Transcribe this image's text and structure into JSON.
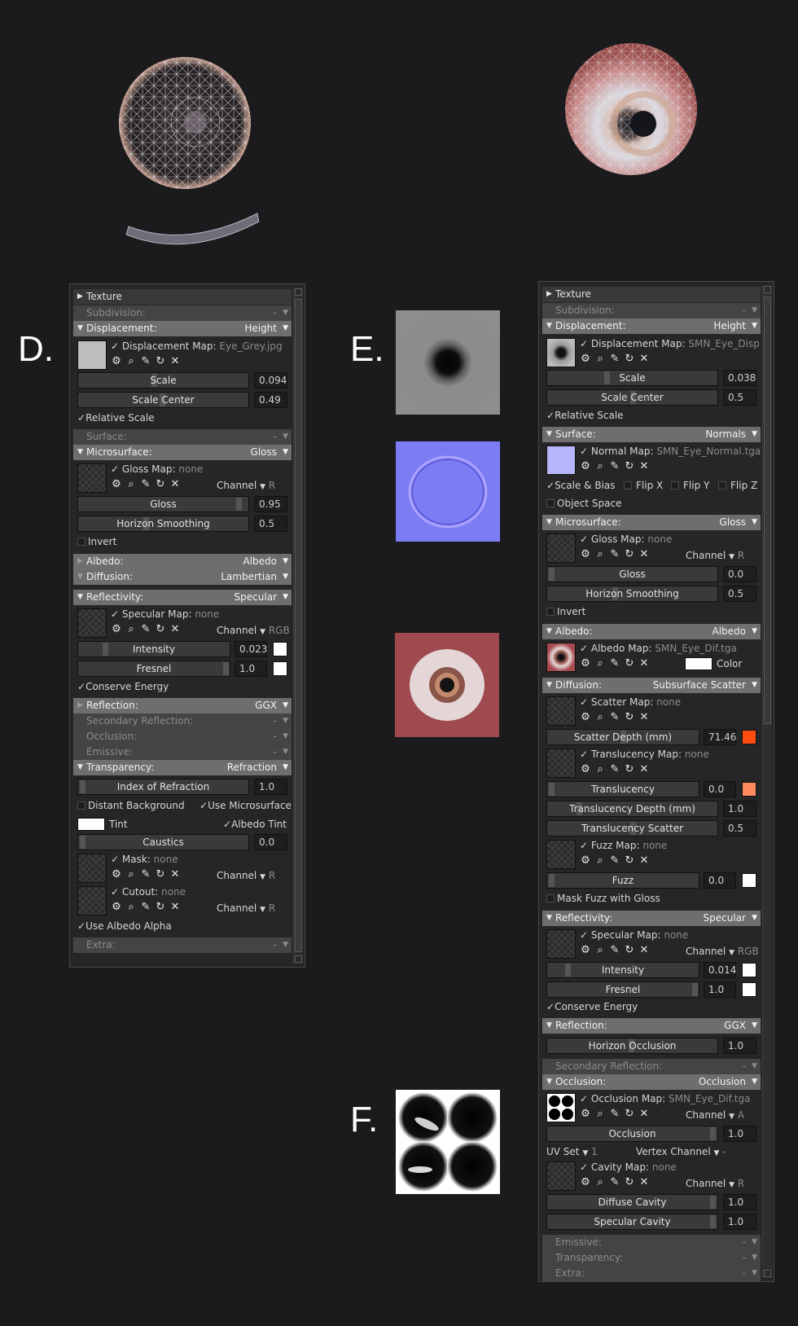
{
  "letters": {
    "d": "D.",
    "e": "E.",
    "f": "F."
  },
  "icons": {
    "gear": "⚙",
    "magnifier": "⌕",
    "pencil": "✎",
    "reload": "↻",
    "close": "✕",
    "check": "✓",
    "tri_right": "▶",
    "tri_down": "▼",
    "dropdown": "▼"
  },
  "colors": {
    "white": "#ffffff",
    "scatter": "#ff4d12",
    "translucency": "#ff8a5c",
    "bg": "#1b1b1d"
  },
  "left": {
    "texture": "Texture",
    "subdivision": "Subdivision:",
    "dash": "-",
    "displacement": "Displacement:",
    "displacement_mode": "Height",
    "disp_map_label": "Displacement Map:",
    "disp_map_file": "Eye_Grey.jpg",
    "scale": "Scale",
    "scale_val": "0.094",
    "scale_center": "Scale Center",
    "scale_center_val": "0.49",
    "relative_scale": "Relative Scale",
    "surface": "Surface:",
    "microsurface": "Microsurface:",
    "micro_mode": "Gloss",
    "gloss_map": "Gloss Map:",
    "none": "none",
    "channel": "Channel",
    "ch_r": "R",
    "gloss": "Gloss",
    "gloss_val": "0.95",
    "horizon": "Horizon Smoothing",
    "horizon_val": "0.5",
    "invert": "Invert",
    "albedo": "Albedo:",
    "albedo_mode": "Albedo",
    "diffusion": "Diffusion:",
    "diffusion_mode": "Lambertian",
    "reflectivity": "Reflectivity:",
    "refl_mode": "Specular",
    "spec_map": "Specular Map:",
    "ch_rgb": "RGB",
    "intensity": "Intensity",
    "intensity_val": "0.023",
    "fresnel": "Fresnel",
    "fresnel_val": "1.0",
    "conserve": "Conserve Energy",
    "reflection": "Reflection:",
    "reflection_mode": "GGX",
    "secondary": "Secondary Reflection:",
    "occlusion": "Occlusion:",
    "emissive": "Emissive:",
    "transparency": "Transparency:",
    "transparency_mode": "Refraction",
    "ior": "Index of Refraction",
    "ior_val": "1.0",
    "distant_bg": "Distant Background",
    "use_micro": "Use Microsurface",
    "tint": "Tint",
    "albedo_tint": "Albedo Tint",
    "caustics": "Caustics",
    "caustics_val": "0.0",
    "mask": "Mask:",
    "cutout": "Cutout:",
    "use_albedo_alpha": "Use Albedo Alpha",
    "extra": "Extra:"
  },
  "right": {
    "texture": "Texture",
    "subdivision": "Subdivision:",
    "dash": "-",
    "displacement": "Displacement:",
    "displacement_mode": "Height",
    "disp_map_label": "Displacement Map:",
    "disp_map_file": "SMN_Eye_Displace.tg",
    "scale": "Scale",
    "scale_val": "0.038",
    "scale_center": "Scale Center",
    "scale_center_val": "0.5",
    "relative_scale": "Relative Scale",
    "surface": "Surface:",
    "surface_mode": "Normals",
    "normal_map": "Normal Map:",
    "normal_file": "SMN_Eye_Normal.tga",
    "scale_bias": "Scale & Bias",
    "flip_x": "Flip X",
    "flip_y": "Flip Y",
    "flip_z": "Flip Z",
    "object_space": "Object Space",
    "microsurface": "Microsurface:",
    "micro_mode": "Gloss",
    "gloss_map": "Gloss Map:",
    "none": "none",
    "channel": "Channel",
    "ch_r": "R",
    "gloss": "Gloss",
    "gloss_val": "0.0",
    "horizon": "Horizon Smoothing",
    "horizon_val": "0.5",
    "invert": "Invert",
    "albedo": "Albedo:",
    "albedo_mode": "Albedo",
    "albedo_map": "Albedo Map:",
    "albedo_file": "SMN_Eye_Dif.tga",
    "color": "Color",
    "diffusion": "Diffusion:",
    "diffusion_mode": "Subsurface Scatter",
    "scatter_map": "Scatter Map:",
    "scatter_depth": "Scatter Depth (mm)",
    "scatter_depth_val": "71.46",
    "transl_map": "Translucency Map:",
    "translucency": "Translucency",
    "translucency_val": "0.0",
    "transl_depth": "Translucency Depth (mm)",
    "transl_depth_val": "1.0",
    "transl_scatter": "Translucency Scatter",
    "transl_scatter_val": "0.5",
    "fuzz_map": "Fuzz Map:",
    "fuzz": "Fuzz",
    "fuzz_val": "0.0",
    "mask_fuzz": "Mask Fuzz with Gloss",
    "reflectivity": "Reflectivity:",
    "refl_mode": "Specular",
    "spec_map": "Specular Map:",
    "ch_rgb": "RGB",
    "intensity": "Intensity",
    "intensity_val": "0.014",
    "fresnel": "Fresnel",
    "fresnel_val": "1.0",
    "conserve": "Conserve Energy",
    "reflection": "Reflection:",
    "reflection_mode": "GGX",
    "horizon_occ": "Horizon Occlusion",
    "horizon_occ_val": "1.0",
    "secondary": "Secondary Reflection:",
    "occlusion": "Occlusion:",
    "occlusion_mode": "Occlusion",
    "occ_map": "Occlusion Map:",
    "occ_file": "SMN_Eye_Dif.tga",
    "ch_a": "A",
    "occ": "Occlusion",
    "occ_val": "1.0",
    "uv_set": "UV Set",
    "uv_val": "1",
    "vertex_channel": "Vertex Channel",
    "cavity_map": "Cavity Map:",
    "diffuse_cavity": "Diffuse Cavity",
    "diffuse_cavity_val": "1.0",
    "specular_cavity": "Specular Cavity",
    "specular_cavity_val": "1.0",
    "emissive": "Emissive:",
    "transparency": "Transparency:",
    "extra": "Extra:"
  }
}
